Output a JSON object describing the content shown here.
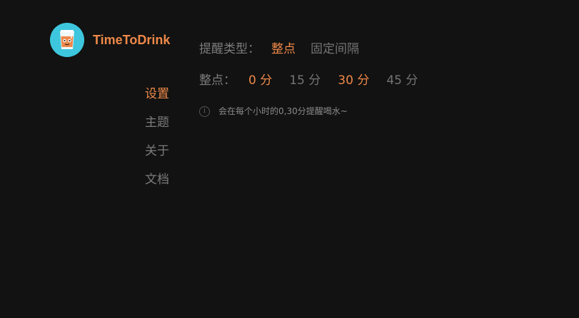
{
  "app": {
    "title": "TimeToDrink",
    "logo_icon": "drink-cup-icon",
    "colors": {
      "background": "#111211",
      "accent": "#ee8849",
      "logo_bg": "#3dc6dd",
      "muted": "#7c7c7c"
    }
  },
  "sidebar": {
    "items": [
      {
        "label": "设置",
        "active": true
      },
      {
        "label": "主题",
        "active": false
      },
      {
        "label": "关于",
        "active": false
      },
      {
        "label": "文档",
        "active": false
      }
    ]
  },
  "settings": {
    "reminder_type": {
      "label": "提醒类型：",
      "options": [
        {
          "label": "整点",
          "selected": true
        },
        {
          "label": "固定间隔",
          "selected": false
        }
      ]
    },
    "on_the_hour": {
      "label": "整点：",
      "options": [
        {
          "label": "0 分",
          "selected": true
        },
        {
          "label": "15 分",
          "selected": false
        },
        {
          "label": "30 分",
          "selected": true
        },
        {
          "label": "45 分",
          "selected": false
        }
      ]
    },
    "hint": {
      "icon": "info-icon",
      "text": "会在每个小时的0,30分提醒喝水~"
    }
  }
}
